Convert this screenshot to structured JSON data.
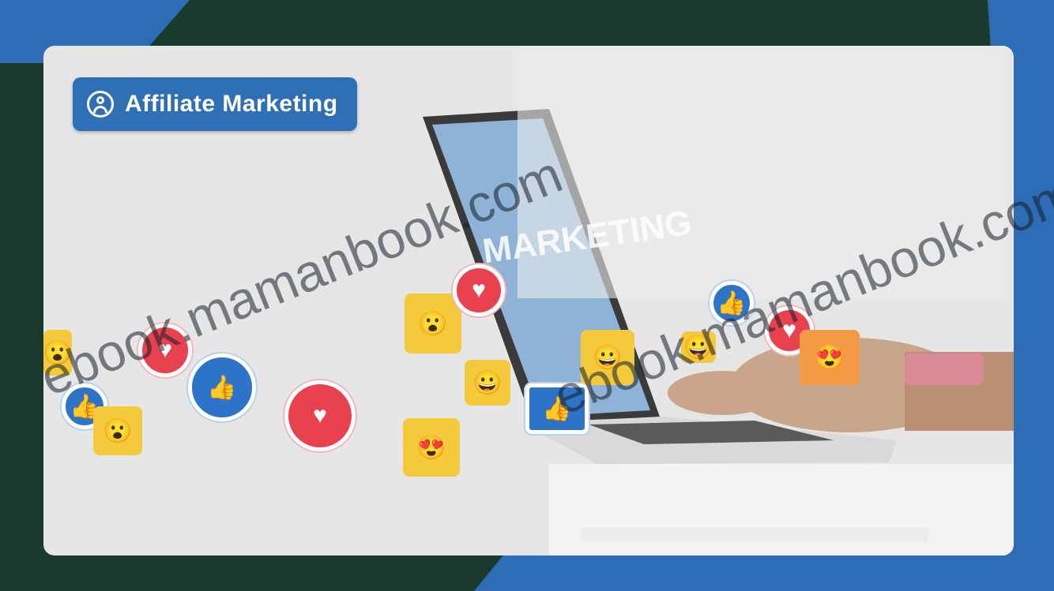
{
  "badge": {
    "icon": "user-circle-icon",
    "label": "Affiliate Marketing"
  },
  "watermarks": [
    "ebook.mamanbook.com",
    "ebook.mamanbook.com"
  ],
  "laptop_screen_text": "MARKETING",
  "colors": {
    "badge_bg": "#2f6fb6",
    "frame_dark": "#1a3a2e",
    "frame_blue": "#2e6db5",
    "card_bg": "#e6e6e6",
    "heart_red": "#e8424f",
    "like_blue": "#2d74c8",
    "emoji_yellow": "#f4c93c"
  },
  "reactions": [
    "heart-icon",
    "like-icon",
    "wow-face-icon",
    "smile-face-icon",
    "heart-eyes-face-icon"
  ]
}
